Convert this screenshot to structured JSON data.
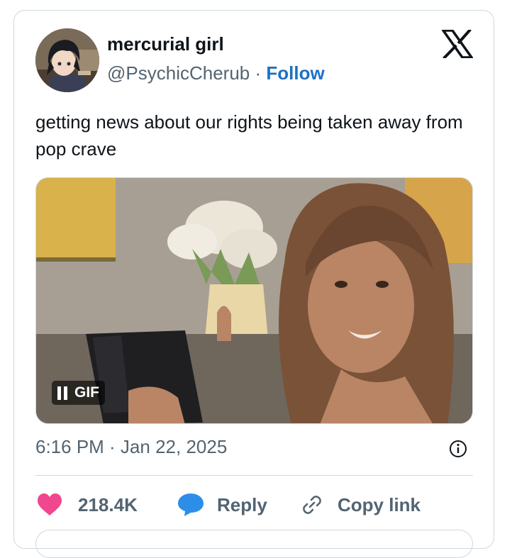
{
  "author": {
    "display_name": "mercurial girl",
    "handle": "@PsychicCherub",
    "separator": "·",
    "follow_label": "Follow"
  },
  "tweet": {
    "text": "getting news about our rights being taken away from pop crave",
    "timestamp": "6:16 PM · Jan 22, 2025"
  },
  "media": {
    "badge_label": "GIF"
  },
  "actions": {
    "likes": "218.4K",
    "reply_label": "Reply",
    "copy_link_label": "Copy link"
  },
  "colors": {
    "follow": "#1d71c4",
    "like": "#f0478e",
    "reply": "#2d8ee8",
    "muted": "#536471",
    "border": "#cfd9de"
  }
}
